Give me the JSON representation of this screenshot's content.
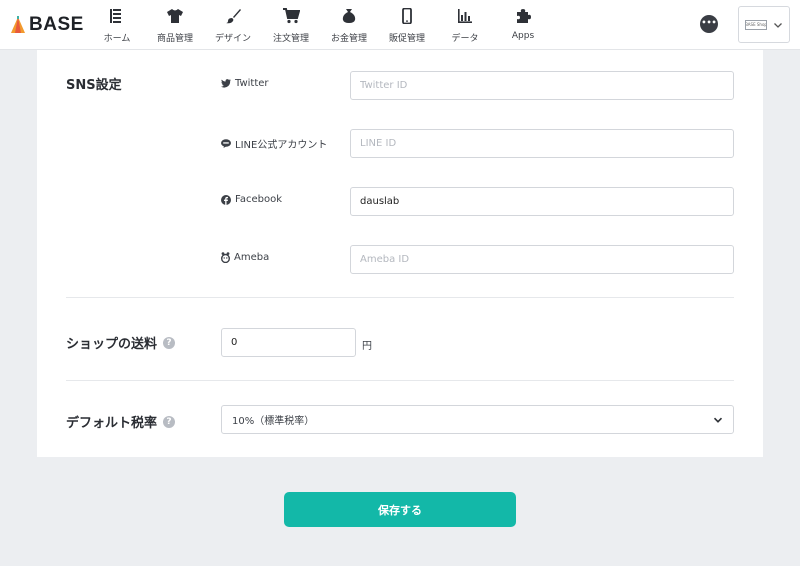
{
  "header": {
    "logo_text": "BASE",
    "nav": [
      {
        "label": "ホーム",
        "icon": "home-list-icon"
      },
      {
        "label": "商品管理",
        "icon": "tshirt-icon"
      },
      {
        "label": "デザイン",
        "icon": "brush-icon"
      },
      {
        "label": "注文管理",
        "icon": "cart-icon"
      },
      {
        "label": "お金管理",
        "icon": "money-bag-icon"
      },
      {
        "label": "販促管理",
        "icon": "smartphone-icon"
      },
      {
        "label": "データ",
        "icon": "bar-chart-icon"
      },
      {
        "label": "Apps",
        "icon": "puzzle-icon"
      }
    ],
    "chat_icon": "chat-bubble-icon",
    "chat_text": "•••",
    "shop_thumb_text": "BASE Shop"
  },
  "sns": {
    "title": "SNS設定",
    "fields": [
      {
        "label": "Twitter",
        "icon": "twitter-icon",
        "value": "",
        "placeholder": "Twitter ID"
      },
      {
        "label": "LINE公式アカウント",
        "icon": "line-icon",
        "value": "",
        "placeholder": "LINE ID"
      },
      {
        "label": "Facebook",
        "icon": "facebook-icon",
        "value": "dauslab",
        "placeholder": ""
      },
      {
        "label": "Ameba",
        "icon": "ameba-icon",
        "value": "",
        "placeholder": "Ameba ID"
      }
    ]
  },
  "shipping": {
    "title": "ショップの送料",
    "help": "?",
    "value": "0",
    "unit": "円"
  },
  "tax": {
    "title": "デフォルト税率",
    "help": "?",
    "selected": "10%（標準税率）"
  },
  "save_button": "保存する",
  "colors": {
    "accent": "#13b8a8",
    "page_bg": "#eceef1",
    "card_bg": "#ffffff"
  }
}
